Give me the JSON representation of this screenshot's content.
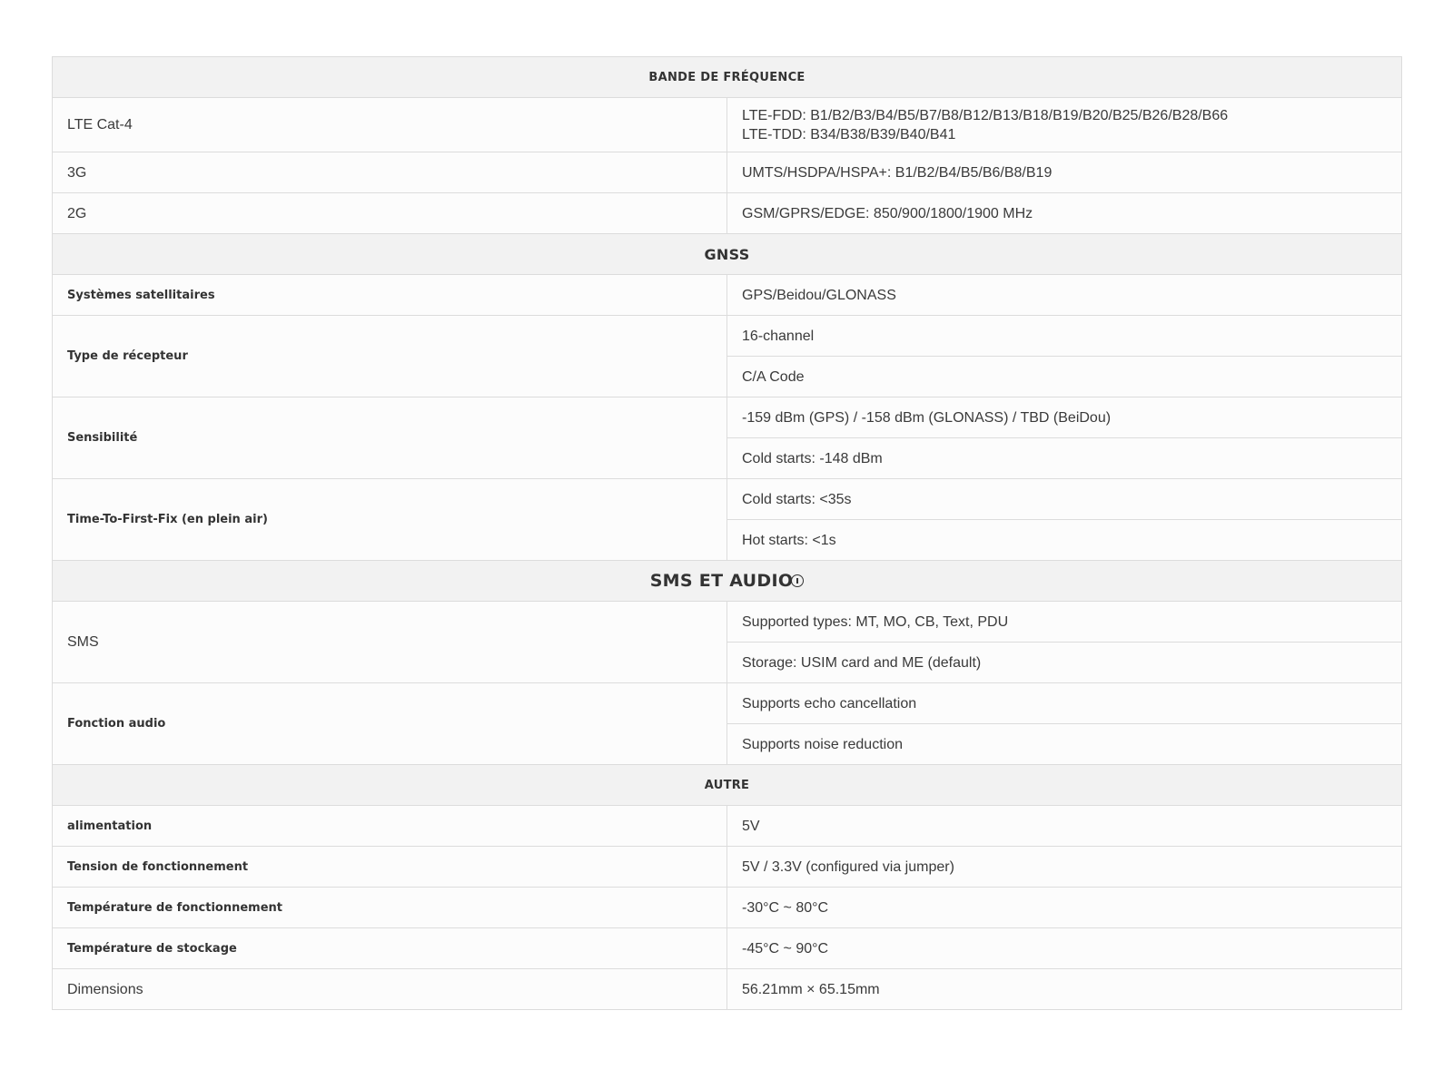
{
  "sections": {
    "frequency": "BANDE DE FRÉQUENCE",
    "gnss": "GNSS",
    "sms_audio": "SMS ET AUDIO",
    "other": "AUTRE"
  },
  "frequency_rows": [
    {
      "label": "LTE Cat-4",
      "values": [
        "LTE-FDD: B1/B2/B3/B4/B5/B7/B8/B12/B13/B18/B19/B20/B25/B26/B28/B66",
        "LTE-TDD: B34/B38/B39/B40/B41"
      ]
    },
    {
      "label": "3G",
      "values": [
        "UMTS/HSDPA/HSPA+: B1/B2/B4/B5/B6/B8/B19"
      ]
    },
    {
      "label": "2G",
      "values": [
        "GSM/GPRS/EDGE: 850/900/1800/1900 MHz"
      ]
    }
  ],
  "gnss_rows": [
    {
      "label": "Systèmes satellitaires",
      "values": [
        "GPS/Beidou/GLONASS"
      ]
    },
    {
      "label": "Type de récepteur",
      "values": [
        "16-channel",
        "C/A Code"
      ]
    },
    {
      "label": "Sensibilité",
      "values": [
        "-159 dBm (GPS) / -158 dBm (GLONASS) / TBD (BeiDou)",
        "Cold starts: -148 dBm"
      ]
    },
    {
      "label": "Time-To-First-Fix (en plein air)",
      "values": [
        "Cold starts: <35s",
        "Hot starts: <1s"
      ]
    }
  ],
  "sms_audio_rows": [
    {
      "label": "SMS",
      "values": [
        "Supported types: MT, MO, CB, Text, PDU",
        "Storage: USIM card and ME (default)"
      ]
    },
    {
      "label": "Fonction audio",
      "values": [
        "Supports echo cancellation",
        "Supports noise reduction"
      ]
    }
  ],
  "other_rows": [
    {
      "label": "alimentation",
      "values": [
        "5V"
      ]
    },
    {
      "label": "Tension de fonctionnement",
      "values": [
        "5V / 3.3V (configured via jumper)"
      ]
    },
    {
      "label": "Température de fonctionnement",
      "values": [
        "-30°C ~ 80°C"
      ]
    },
    {
      "label": "Température de stockage",
      "values": [
        "-45°C ~ 90°C"
      ]
    },
    {
      "label": "Dimensions",
      "values": [
        "56.21mm × 65.15mm"
      ]
    }
  ]
}
